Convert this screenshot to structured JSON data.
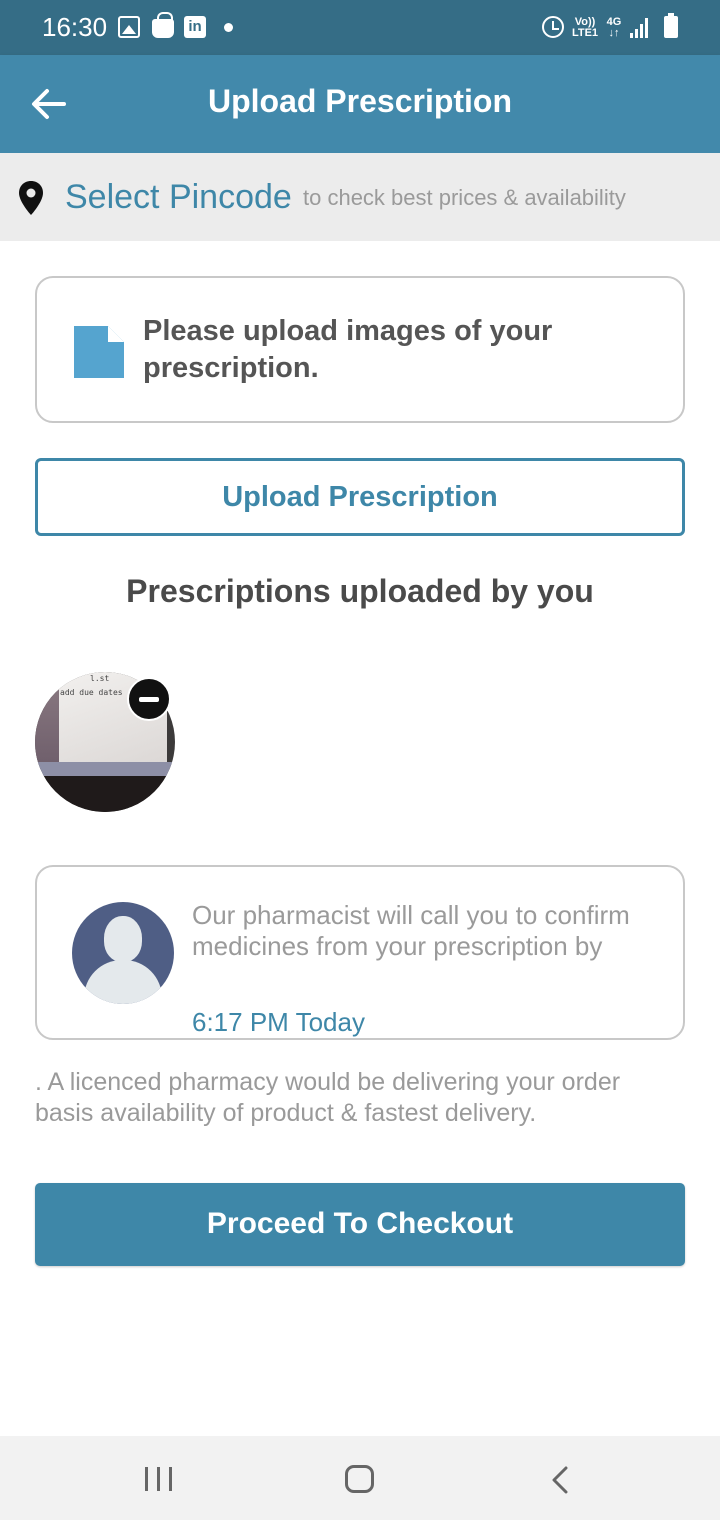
{
  "status_bar": {
    "time": "16:30",
    "icons": [
      "gallery-icon",
      "shopping-bag-icon",
      "linkedin-icon",
      "notification-dot-icon",
      "alarm-icon",
      "volte-icon",
      "4g-icon",
      "signal-icon",
      "battery-icon"
    ],
    "linkedin_glyph": "in",
    "volte_top": "Vo))",
    "volte_bottom": "LTE1",
    "network_top": "4G",
    "network_bottom": "↓↑"
  },
  "app_bar": {
    "title": "Upload Prescription",
    "background": "#4289ab"
  },
  "pincode": {
    "select_label": "Select Pincode",
    "hint": "to check best prices & availability"
  },
  "info_card": {
    "message": "Please upload images of your prescription."
  },
  "upload_button": {
    "label": "Upload Prescription"
  },
  "uploaded_section": {
    "heading": "Prescriptions uploaded by you",
    "thumbnail_text_1": "l.st",
    "thumbnail_text_2": "add due dates"
  },
  "pharmacist_card": {
    "message": "Our pharmacist will call you to confirm medicines from your prescription by",
    "time": "6:17 PM Today"
  },
  "licence_note": ". A licenced pharmacy would be delivering your order basis availability of product & fastest delivery.",
  "checkout_button": {
    "label": "Proceed To Checkout"
  },
  "colors": {
    "accent": "#3e87a8",
    "status_bar": "#356d86",
    "muted_text": "#9a9a9a",
    "heading_text": "#4a4a4a"
  }
}
